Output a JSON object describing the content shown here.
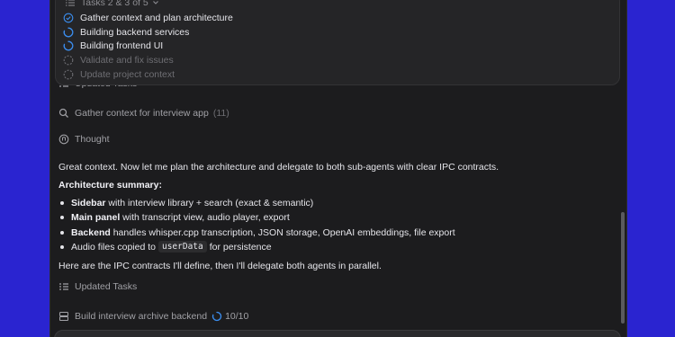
{
  "tasks_popup": {
    "header": "Tasks 2 & 3 of 5",
    "items": [
      {
        "label": "Gather context and plan architecture",
        "status": "done"
      },
      {
        "label": "Building backend services",
        "status": "in-progress"
      },
      {
        "label": "Building frontend UI",
        "status": "in-progress"
      },
      {
        "label": "Validate and fix issues",
        "status": "pending"
      },
      {
        "label": "Update project context",
        "status": "pending"
      }
    ]
  },
  "feed": {
    "updated_tasks_top": "Updated Tasks",
    "gather_context": {
      "label": "Gather context for interview app",
      "count": "(11)"
    },
    "thought": "Thought",
    "intro": "Great context. Now let me plan the architecture and delegate to both sub-agents with clear IPC contracts.",
    "summary_heading": "Architecture summary:",
    "bullets": [
      {
        "bold": "Sidebar",
        "text": " with interview library + search (exact & semantic)"
      },
      {
        "bold": "Main panel",
        "text": " with transcript view, audio player, export"
      },
      {
        "bold": "Backend",
        "text": " handles whisper.cpp transcription, JSON storage, OpenAI embeddings, file export"
      },
      {
        "pre": "Audio files copied to",
        "code": "userData",
        "post": "for persistence"
      }
    ],
    "closing": "Here are the IPC contracts I'll define, then I'll delegate both agents in parallel.",
    "updated_tasks": "Updated Tasks",
    "build_backend": {
      "label": "Build interview archive backend",
      "progress": "10/10"
    }
  },
  "colors": {
    "background": "#2a24d0",
    "window": "#1c1c1e",
    "accent": "#3b8ef0"
  }
}
